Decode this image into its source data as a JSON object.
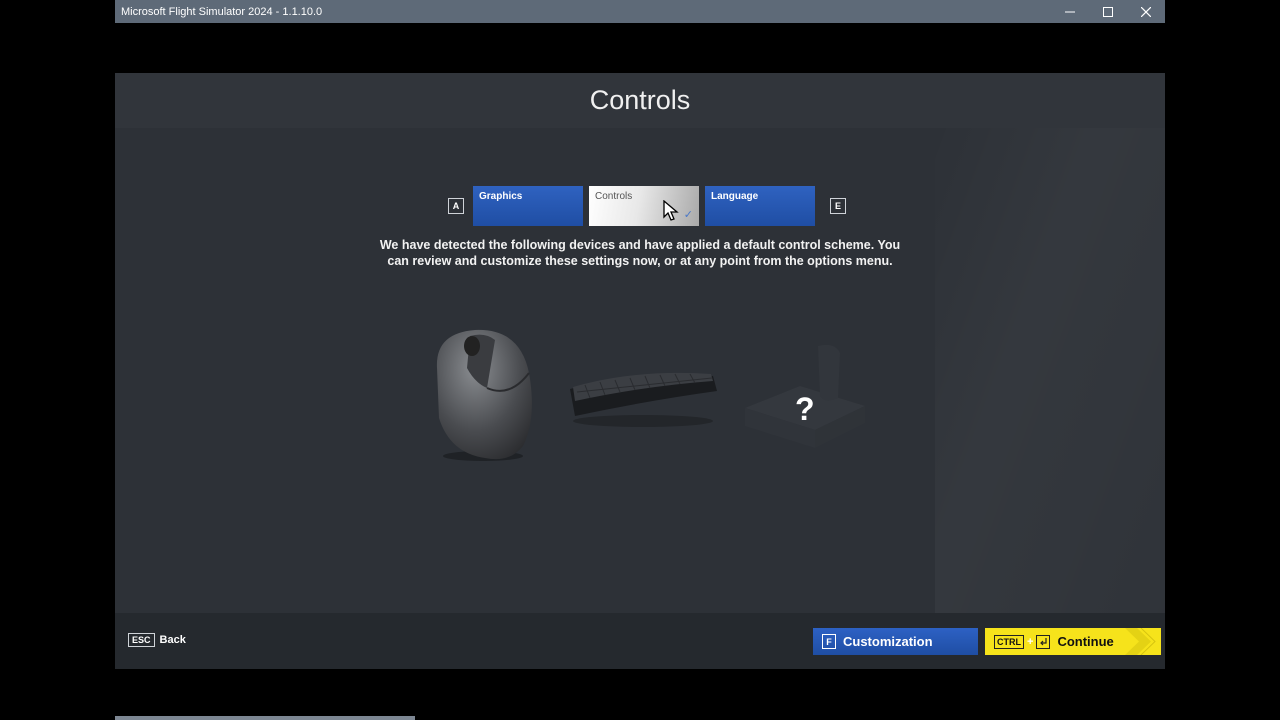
{
  "window": {
    "title": "Microsoft Flight Simulator 2024 - 1.1.10.0",
    "minimize_icon": "minimize-icon",
    "maximize_icon": "maximize-icon",
    "close_icon": "close-icon"
  },
  "header": {
    "title": "Controls"
  },
  "tabs": {
    "prev_key": "A",
    "next_key": "E",
    "items": [
      {
        "label": "Graphics",
        "active": false
      },
      {
        "label": "Controls",
        "active": true
      },
      {
        "label": "Language",
        "active": false
      }
    ]
  },
  "description": {
    "line1": "We have detected the following devices and have applied a default control scheme. You",
    "line2": "can review and customize these settings now, or at any point from the options menu."
  },
  "devices": [
    {
      "icon": "mouse-icon",
      "detected": true
    },
    {
      "icon": "keyboard-icon",
      "detected": true
    },
    {
      "icon": "joystick-icon",
      "detected": false,
      "status": "?"
    }
  ],
  "footer": {
    "back_key": "ESC",
    "back_label": "Back",
    "customization_key": "F",
    "customization_label": "Customization",
    "continue_key": "CTRL",
    "continue_plus": "+",
    "continue_label": "Continue"
  },
  "colors": {
    "accent_blue": "#2a5bb8",
    "continue_yellow": "#f6e31b",
    "background": "#2d3137"
  }
}
